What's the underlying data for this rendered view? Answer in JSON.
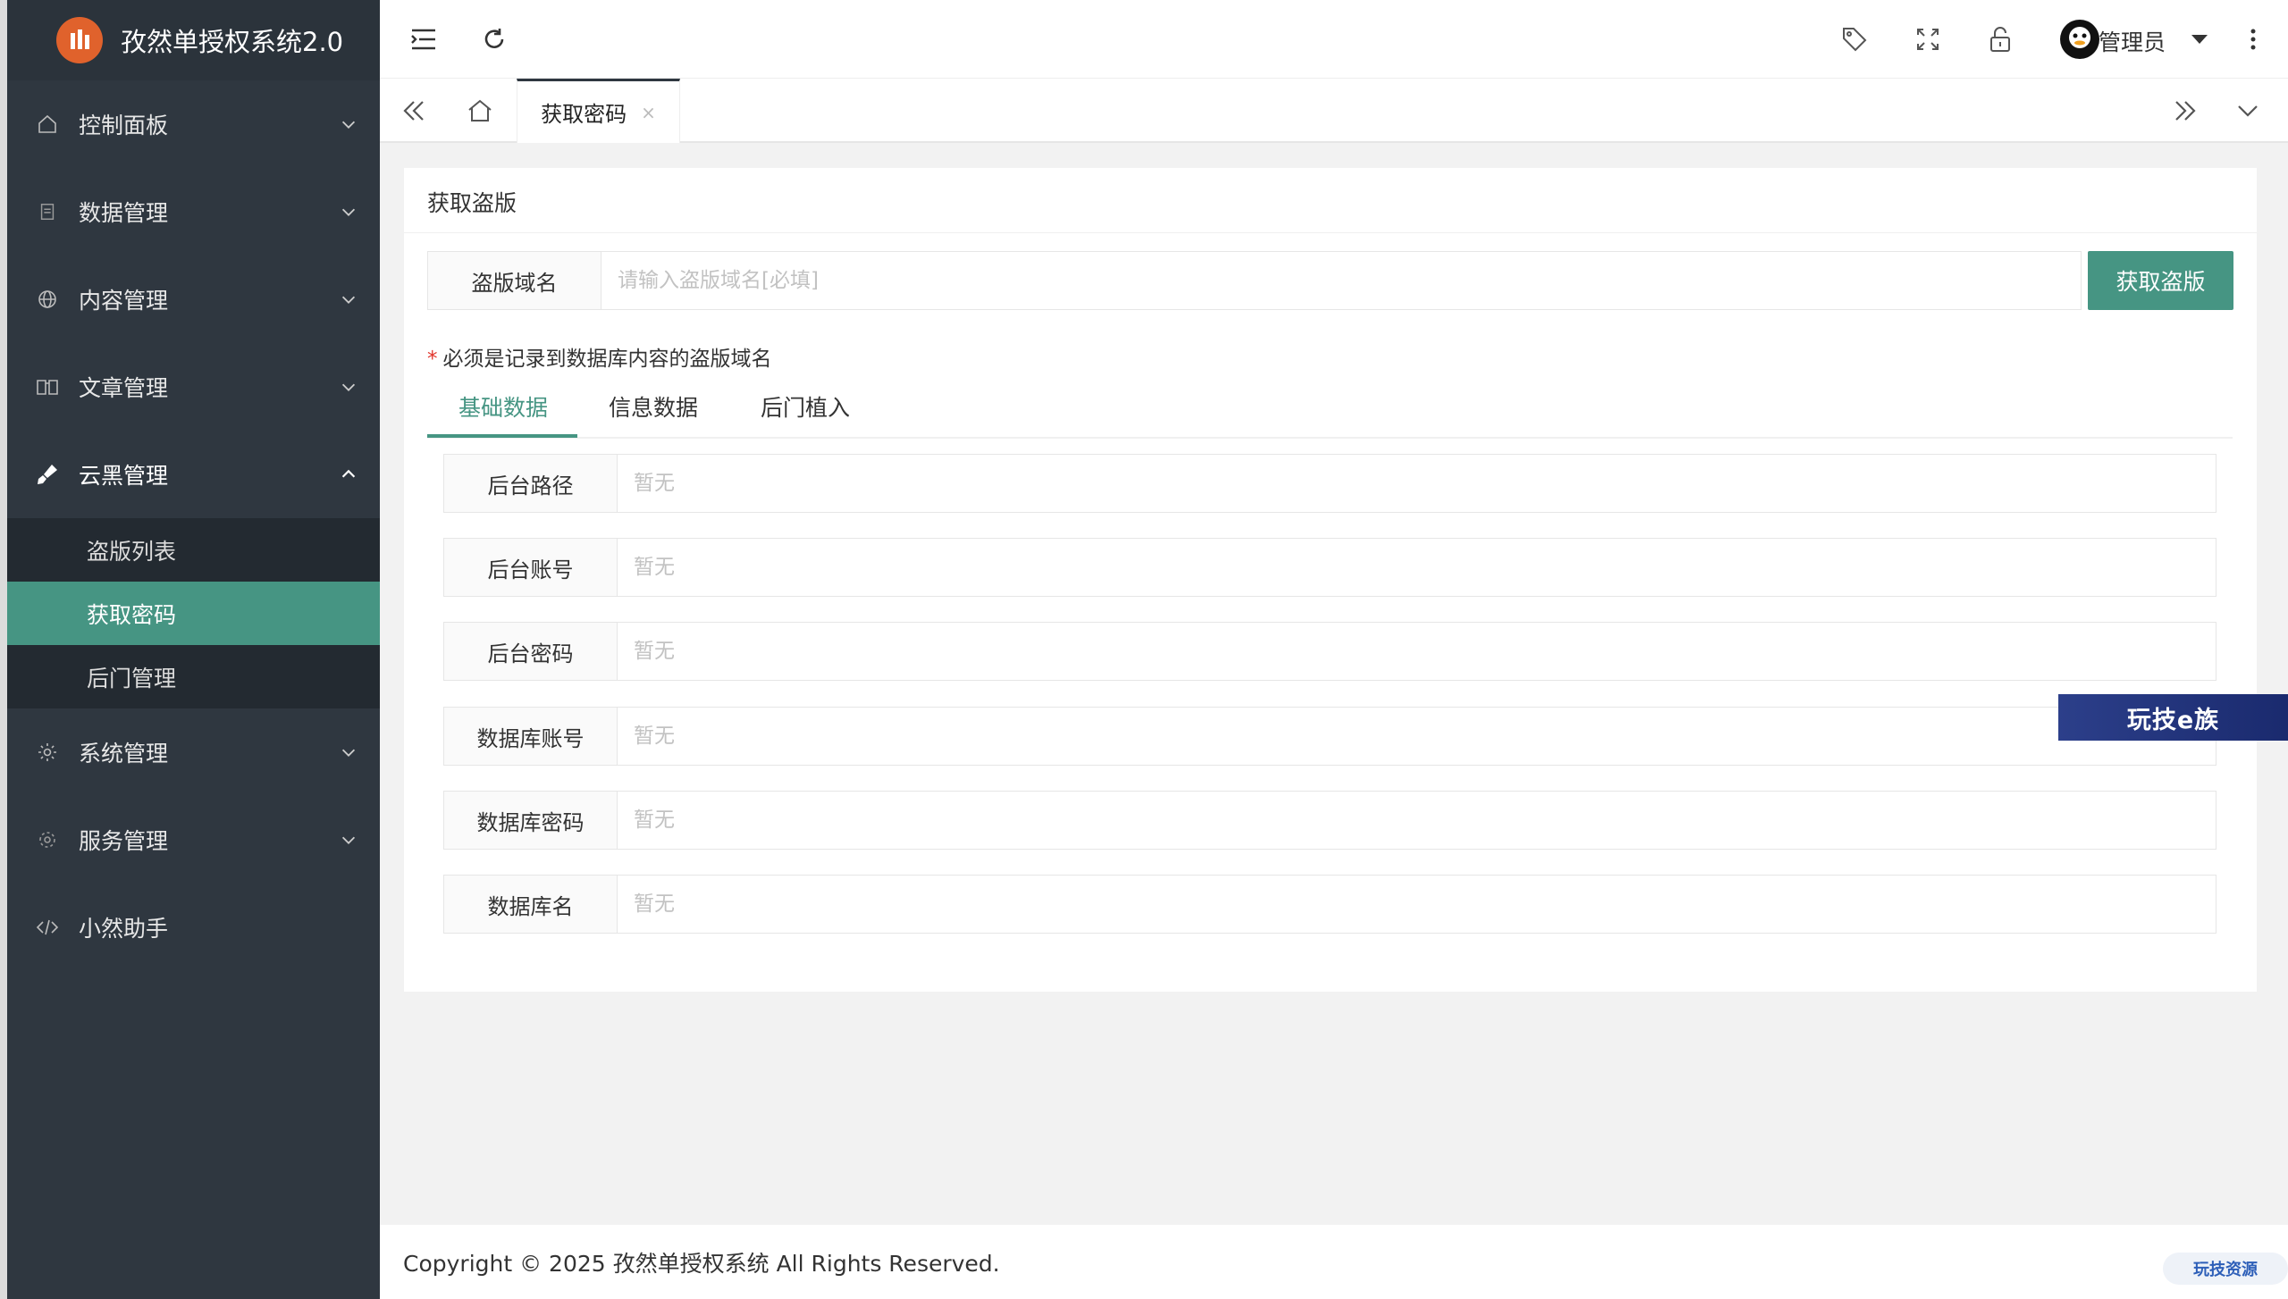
{
  "app": {
    "title": "孜然单授权系统2.0"
  },
  "sidebar": {
    "items": [
      {
        "label": "控制面板",
        "icon": "home-icon"
      },
      {
        "label": "数据管理",
        "icon": "file-icon"
      },
      {
        "label": "内容管理",
        "icon": "globe-icon"
      },
      {
        "label": "文章管理",
        "icon": "book-icon"
      },
      {
        "label": "云黑管理",
        "icon": "brush-icon"
      },
      {
        "label": "系统管理",
        "icon": "gear-icon"
      },
      {
        "label": "服务管理",
        "icon": "service-icon"
      },
      {
        "label": "小然助手",
        "icon": "code-icon"
      }
    ],
    "subitems": [
      {
        "label": "盗版列表"
      },
      {
        "label": "获取密码"
      },
      {
        "label": "后门管理"
      }
    ]
  },
  "header": {
    "admin_name": "管理员"
  },
  "tabs": {
    "active_label": "获取密码",
    "close": "×"
  },
  "card": {
    "title": "获取盗版",
    "domain_label": "盗版域名",
    "domain_placeholder": "请输入盗版域名[必填]",
    "fetch_button": "获取盗版",
    "hint_star": "*",
    "hint": "必须是记录到数据库内容的盗版域名"
  },
  "inner_tabs": [
    {
      "label": "基础数据"
    },
    {
      "label": "信息数据"
    },
    {
      "label": "后门植入"
    }
  ],
  "fields": [
    {
      "label": "后台路径",
      "placeholder": "暂无"
    },
    {
      "label": "后台账号",
      "placeholder": "暂无"
    },
    {
      "label": "后台密码",
      "placeholder": "暂无"
    },
    {
      "label": "数据库账号",
      "placeholder": "暂无"
    },
    {
      "label": "数据库密码",
      "placeholder": "暂无"
    },
    {
      "label": "数据库名",
      "placeholder": "暂无"
    }
  ],
  "watermark": {
    "text": "玩技e族",
    "footer_text": "玩技资源"
  },
  "footer": {
    "copyright": "Copyright © 2025 孜然单授权系统 All Rights Reserved."
  },
  "colors": {
    "sidebar": "#2f3740",
    "accent": "#469583",
    "required": "#e1352c"
  }
}
